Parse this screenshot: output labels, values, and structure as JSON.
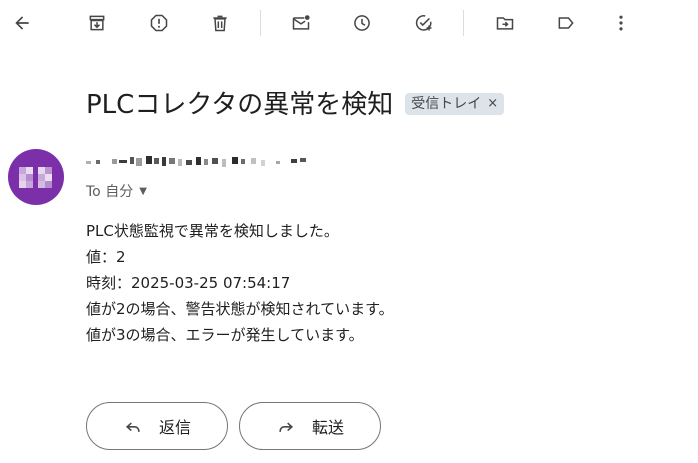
{
  "toolbar": {
    "icons": [
      "back-arrow-icon",
      "archive-icon",
      "report-spam-icon",
      "delete-icon",
      "mark-unread-icon",
      "snooze-icon",
      "add-to-tasks-icon",
      "move-to-icon",
      "label-icon",
      "more-vert-icon"
    ]
  },
  "message": {
    "subject": "PLCコレクタの異常を検知",
    "label_chip": "受信トレイ",
    "label_chip_close": "×",
    "to_line": "To 自分",
    "body_lines": [
      "PLC状態監視で異常を検知しました。",
      "値：2",
      "時刻：2025-03-25 07:54:17",
      "値が2の場合、警告状態が検知されています。",
      "値が3の場合、エラーが発生しています。"
    ]
  },
  "actions": {
    "reply_label": "返信",
    "forward_label": "転送"
  },
  "colors": {
    "avatar": "#7b2fa8",
    "chip_bg": "#dde3ea",
    "icon": "#444746"
  }
}
